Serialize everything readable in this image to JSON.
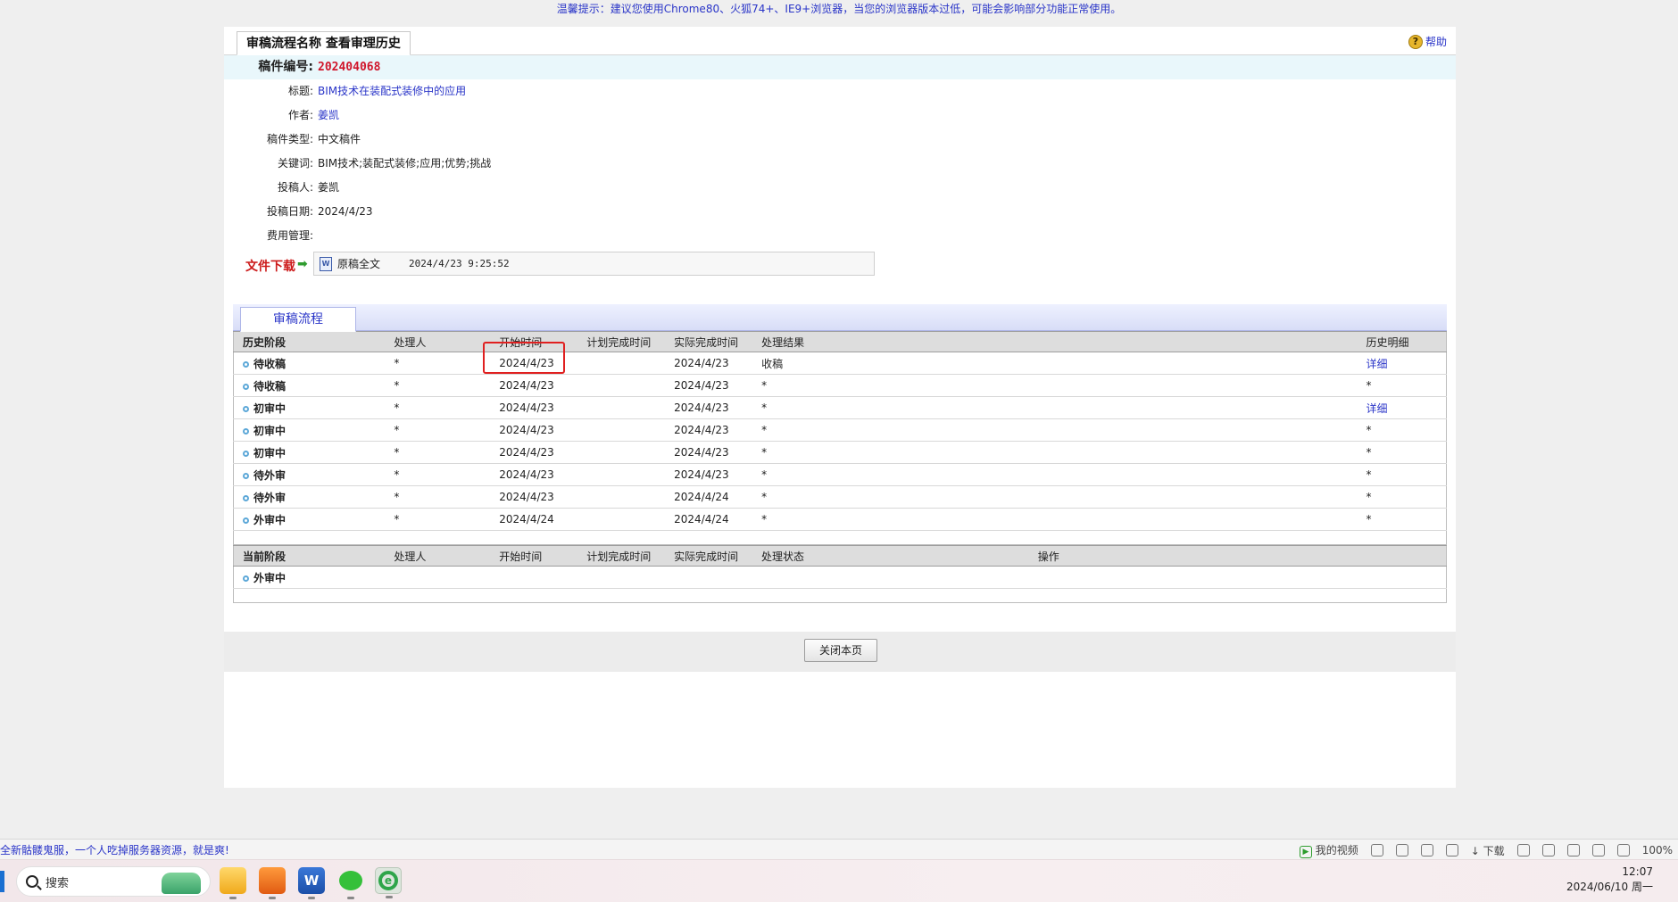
{
  "top_tip": "温馨提示：建议您使用Chrome80、火狐74+、IE9+浏览器，当您的浏览器版本过低，可能会影响部分功能正常使用。",
  "title_tab": "审稿流程名称 查看审理历史",
  "help_label": "帮助",
  "info": {
    "manuscript_no_label": "稿件编号:",
    "manuscript_no": "202404068",
    "title_label": "标题:",
    "title": "BIM技术在装配式装修中的应用",
    "author_label": "作者:",
    "author": "姜凯",
    "type_label": "稿件类型:",
    "type": "中文稿件",
    "keywords_label": "关键词:",
    "keywords": "BIM技术;装配式装修;应用;优势;挑战",
    "submitter_label": "投稿人:",
    "submitter": "姜凯",
    "date_label": "投稿日期:",
    "date": "2024/4/23",
    "fee_label": "费用管理:",
    "fee": ""
  },
  "download": {
    "label": "文件下载",
    "arrow": "➡",
    "file_icon": "doc-icon",
    "file_name": "原稿全文",
    "file_time": "2024/4/23 9:25:52"
  },
  "flow_tab": "审稿流程",
  "history": {
    "headers": [
      "历史阶段",
      "处理人",
      "开始时间",
      "计划完成时间",
      "实际完成时间",
      "处理结果",
      "历史明细"
    ],
    "rows": [
      {
        "stage": "待收稿",
        "handler": "*",
        "start": "2024/4/23",
        "planned": "",
        "actual": "2024/4/23",
        "result": "收稿",
        "detail": "详细"
      },
      {
        "stage": "待收稿",
        "handler": "*",
        "start": "2024/4/23",
        "planned": "",
        "actual": "2024/4/23",
        "result": "*",
        "detail": "*"
      },
      {
        "stage": "初审中",
        "handler": "*",
        "start": "2024/4/23",
        "planned": "",
        "actual": "2024/4/23",
        "result": "*",
        "detail": "详细"
      },
      {
        "stage": "初审中",
        "handler": "*",
        "start": "2024/4/23",
        "planned": "",
        "actual": "2024/4/23",
        "result": "*",
        "detail": "*"
      },
      {
        "stage": "初审中",
        "handler": "*",
        "start": "2024/4/23",
        "planned": "",
        "actual": "2024/4/23",
        "result": "*",
        "detail": "*"
      },
      {
        "stage": "待外审",
        "handler": "*",
        "start": "2024/4/23",
        "planned": "",
        "actual": "2024/4/23",
        "result": "*",
        "detail": "*"
      },
      {
        "stage": "待外审",
        "handler": "*",
        "start": "2024/4/23",
        "planned": "",
        "actual": "2024/4/24",
        "result": "*",
        "detail": "*"
      },
      {
        "stage": "外审中",
        "handler": "*",
        "start": "2024/4/24",
        "planned": "",
        "actual": "2024/4/24",
        "result": "*",
        "detail": "*"
      }
    ]
  },
  "current": {
    "headers": [
      "当前阶段",
      "处理人",
      "开始时间",
      "计划完成时间",
      "实际完成时间",
      "处理状态",
      "操作"
    ],
    "rows": [
      {
        "stage": "外审中"
      }
    ]
  },
  "close_button": "关闭本页",
  "statusbar": {
    "left_text": "全新骷髅鬼服，一个人吃掉服务器资源，就是爽!",
    "my_video": "我的视频",
    "download": "下载",
    "zoom": "100%"
  },
  "taskbar": {
    "search_label": "搜索",
    "time": "12:07",
    "date": "2024/06/10 周一"
  },
  "colors": {
    "link": "#2a35c8",
    "code": "#d0162b",
    "highlight": "#e02020"
  }
}
